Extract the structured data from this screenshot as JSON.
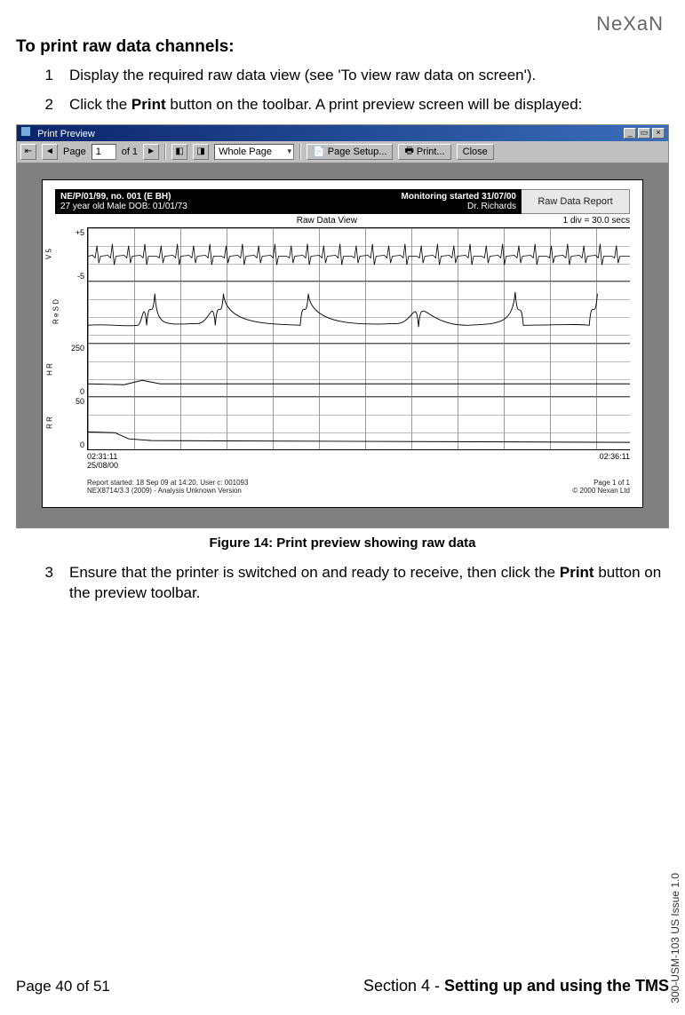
{
  "brand": "NeXaN",
  "heading": "To print raw data channels:",
  "steps": [
    {
      "num": "1",
      "text": "Display the required raw data view (see 'To view raw data on screen')."
    },
    {
      "num": "2",
      "pre": "Click the ",
      "bold": "Print",
      "post": " button on the toolbar. A print preview screen will be displayed:"
    },
    {
      "num": "3",
      "pre": "Ensure that the printer is switched on and ready to receive, then click the ",
      "bold": "Print",
      "post": " button on the preview toolbar."
    }
  ],
  "window": {
    "title": "Print Preview",
    "toolbar": {
      "page_label": "Page",
      "page_value": "1",
      "of_label": "of 1",
      "zoom_value": "Whole Page",
      "page_setup": "Page Setup...",
      "print": "Print...",
      "close": "Close"
    },
    "report": {
      "patient_id": "NE/P/01/99, no. 001 (E BH)",
      "patient_line": "27 year old Male  DOB: 01/01/73",
      "monitor": "Monitoring started 31/07/00",
      "doctor": "Dr. Richards",
      "box_title": "Raw Data Report",
      "view_title": "Raw Data View",
      "scale_note": "1 div = 30.0 secs",
      "time_start": "02:31:11",
      "date_start": "25/08/00",
      "time_end": "02:36:11",
      "footer_left1": "Report started: 18 Sep 09 at 14:20, User c: 001093",
      "footer_left2": "NEX8714/3.3 (2009) - Analysis Unknown Version",
      "footer_right1": "Page 1 of 1",
      "footer_right2": "© 2000 Nexan Ltd"
    }
  },
  "figure_caption": "Figure 14: Print preview showing raw data",
  "chart_data": [
    {
      "type": "line",
      "name": "V 5",
      "ylim": [
        -5,
        5
      ],
      "axis_ticks": [
        "+5",
        "-5"
      ],
      "style": "ecg-dense"
    },
    {
      "type": "line",
      "name": "R e S D",
      "ylim": [
        0,
        10
      ],
      "axis_ticks": [],
      "style": "resp-bursts"
    },
    {
      "type": "line",
      "name": "H R",
      "ylim": [
        0,
        250
      ],
      "axis_ticks": [
        "250",
        "0"
      ],
      "style": "flat-low"
    },
    {
      "type": "line",
      "name": "R R",
      "ylim": [
        0,
        50
      ],
      "axis_ticks": [
        "50",
        "0"
      ],
      "style": "flat-low-decay"
    }
  ],
  "side_doc": "300-USM-103 US Issue 1.0",
  "footer": {
    "page": "Page 40 of 51",
    "section_pre": "Section 4 - ",
    "section_bold": "Setting up and using the TMS"
  }
}
